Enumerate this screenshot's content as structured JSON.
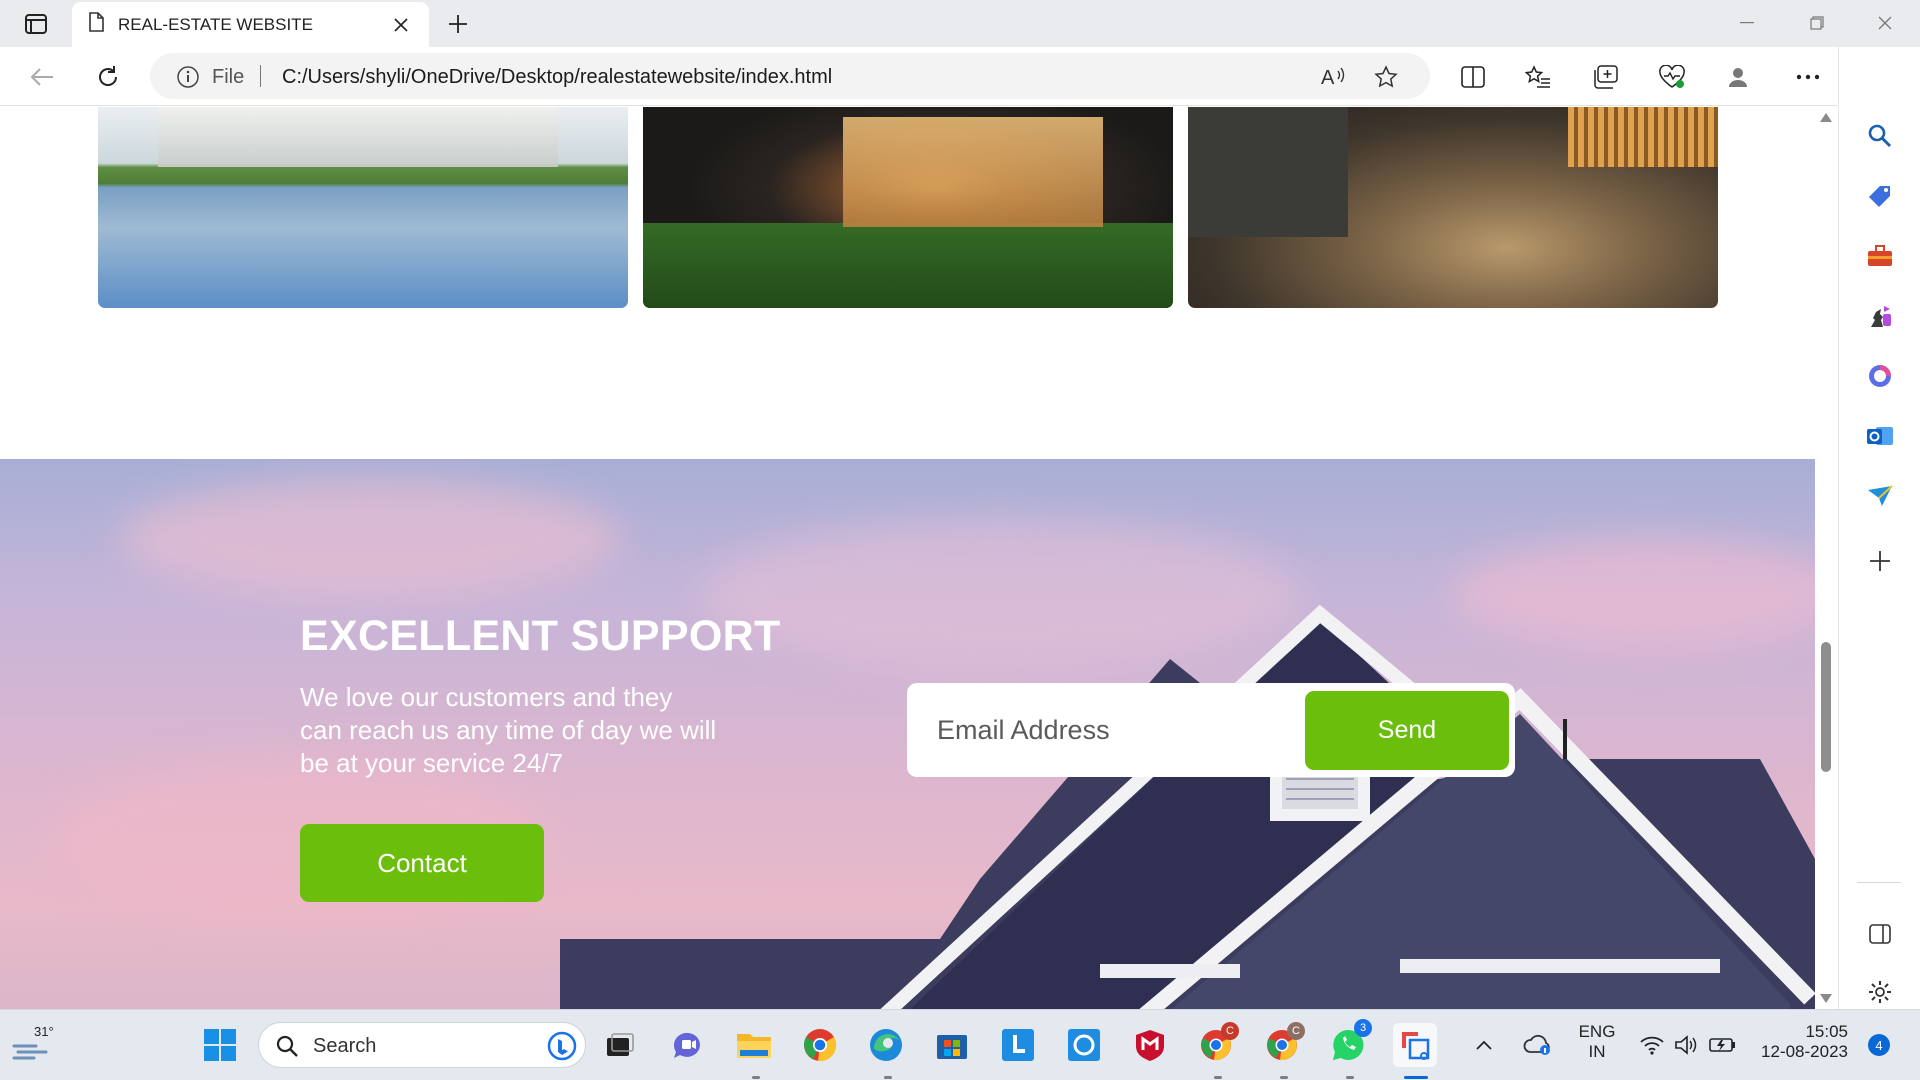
{
  "browser": {
    "tab_title": "REAL-ESTATE WEBSITE",
    "omnibox_scheme": "File",
    "url": "C:/Users/shyli/OneDrive/Desktop/realestatewebsite/index.html"
  },
  "page": {
    "support": {
      "title": "EXCELLENT SUPPORT",
      "text": "We love our customers and they can reach us any time of day we will be at your service 24/7",
      "contact_label": "Contact",
      "email_placeholder": "Email Address",
      "send_label": "Send"
    }
  },
  "taskbar": {
    "temperature": "31°",
    "search_label": "Search",
    "language_line1": "ENG",
    "language_line2": "IN",
    "time": "15:05",
    "date": "12-08-2023",
    "notification_count": "4",
    "whatsapp_badge": "3",
    "chrome1_badge": "C",
    "chrome2_badge": "C"
  },
  "colors": {
    "accent_green": "#6cbe0c",
    "edge_blue": "#0a68d4"
  }
}
